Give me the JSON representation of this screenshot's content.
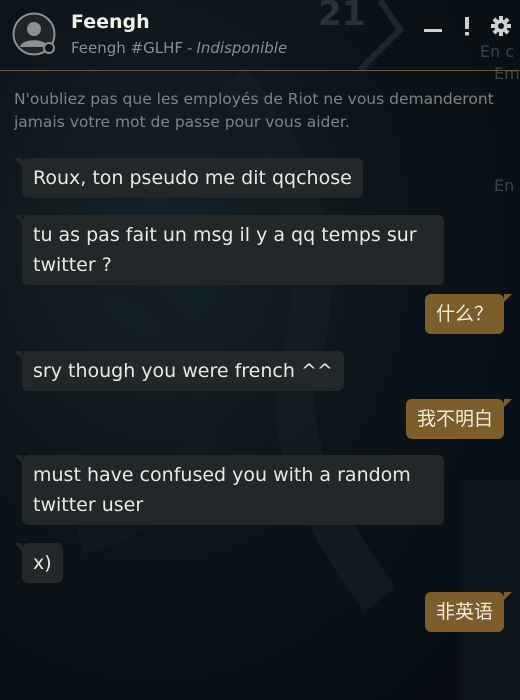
{
  "colors": {
    "incoming_bubble": "#22272a",
    "outgoing_bubble": "#7c5e2c",
    "accent_line": "#6b5a36"
  },
  "header": {
    "name": "Feengh",
    "tag": "Feengh #GLHF",
    "separator": "-",
    "availability": "Indisponible",
    "icons": [
      "minimize-icon",
      "alert-icon",
      "gear-icon"
    ]
  },
  "notice": "N'oubliez pas que les employés de Riot ne vous demanderont jamais votre mot de passe pour vous aider.",
  "messages": [
    {
      "direction": "in",
      "text": "Roux, ton pseudo me dit qqchose"
    },
    {
      "direction": "in",
      "text": "tu as pas fait un msg il y a qq temps sur twitter ?"
    },
    {
      "direction": "out",
      "text": "什么？"
    },
    {
      "direction": "in",
      "text": "sry though you were french ^^"
    },
    {
      "direction": "out",
      "text": "我不明白"
    },
    {
      "direction": "in",
      "text": "must have confused you with a random twitter user"
    },
    {
      "direction": "in",
      "text": "x)"
    },
    {
      "direction": "out",
      "text": "非英语"
    }
  ]
}
